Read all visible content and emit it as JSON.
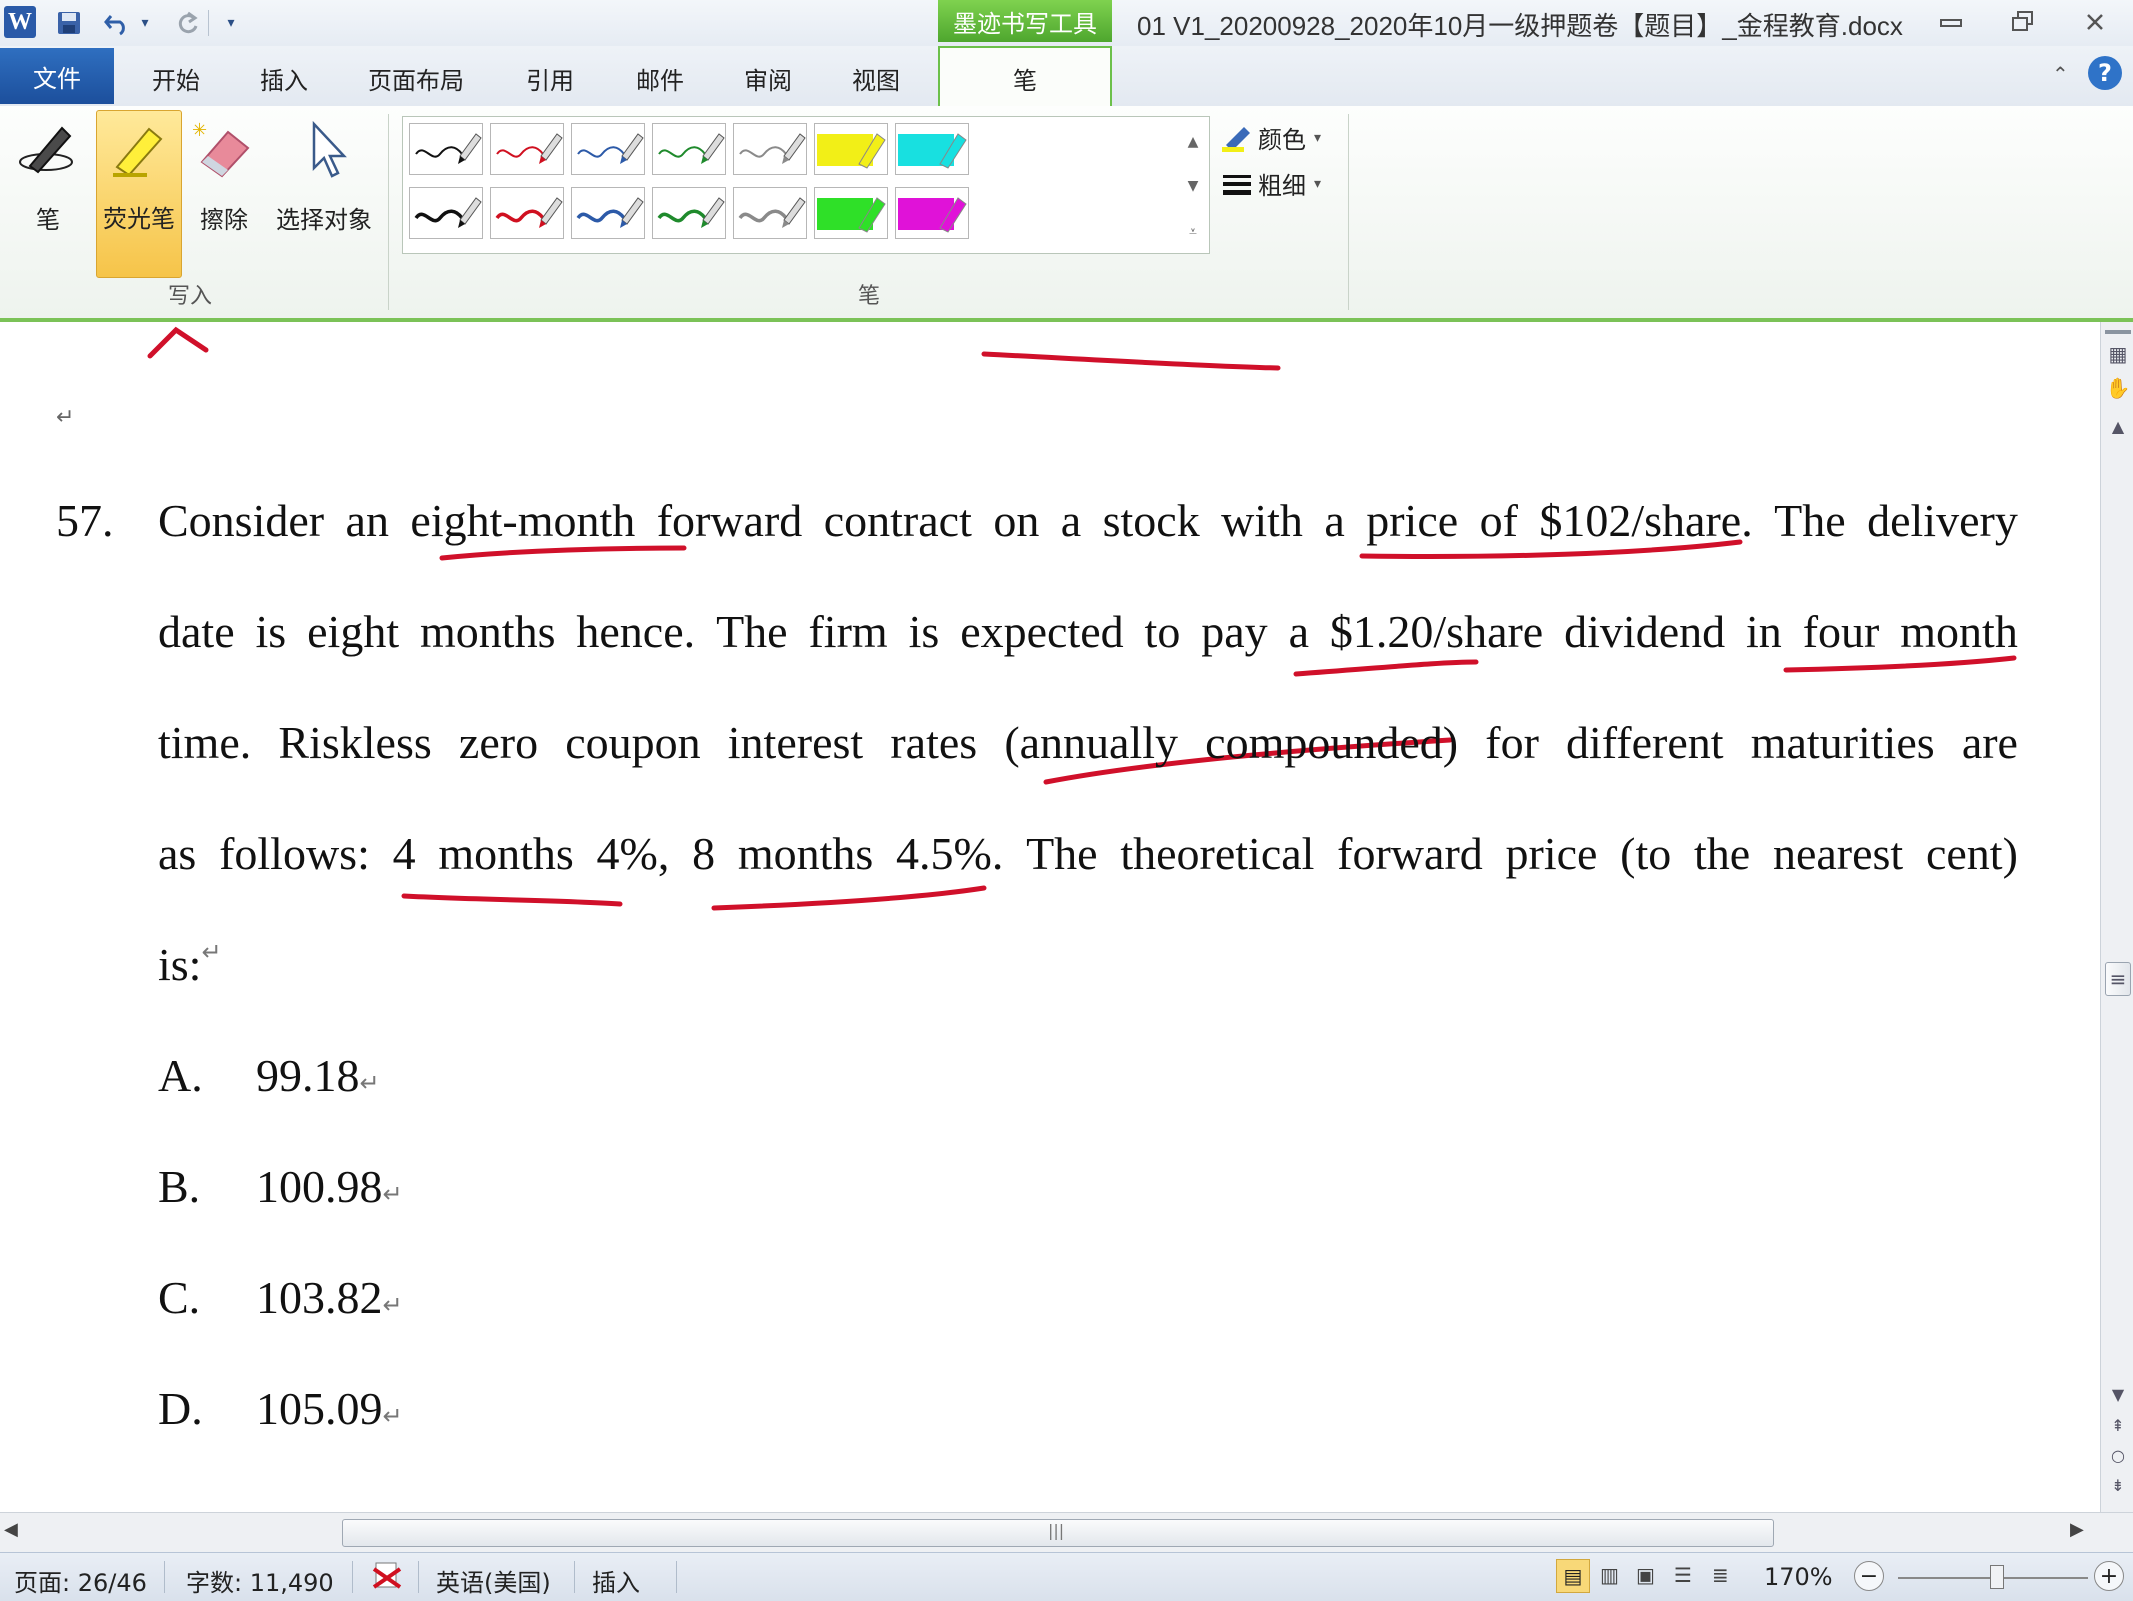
{
  "quick_access": {
    "app_icon": "W",
    "save_icon": "save-icon",
    "undo_icon": "undo-icon",
    "redo_icon": "redo-icon",
    "customize_icon": "chevron-down-icon"
  },
  "title_bar": {
    "context_tab": "墨迹书写工具",
    "document_title": "01 V1_20200928_2020年10月一级押题卷【题目】_金程教育.docx"
  },
  "tabs": [
    "开始",
    "插入",
    "页面布局",
    "引用",
    "邮件",
    "审阅",
    "视图"
  ],
  "file_tab": "文件",
  "active_tab": "笔",
  "ribbon": {
    "write_group": {
      "label": "写入",
      "pen": "笔",
      "highlighter": "荧光笔",
      "eraser": "擦除",
      "select_objects": "选择对象"
    },
    "pens_group": {
      "label": "笔",
      "color": "颜色",
      "weight": "粗细"
    },
    "pen_swatch_colors": [
      "#111111",
      "#d01020",
      "#2c5aa8",
      "#1f8a2c",
      "#8a8a8a",
      "#f2ef17",
      "#18e0e0",
      "#111111",
      "#d01020",
      "#2c5aa8",
      "#1f8a2c",
      "#8a8a8a",
      "#2fe028",
      "#e012d8"
    ]
  },
  "document": {
    "question_number": "57.",
    "question_lines": [
      [
        "Consider",
        "an",
        "eight-month",
        "forward",
        "contract",
        "on",
        "a",
        "stock",
        "with",
        "a",
        "price",
        "of",
        "$102/share.",
        "The",
        "delivery"
      ],
      [
        "date",
        "is",
        "eight",
        "months",
        "hence.",
        "The",
        "firm",
        "is",
        "expected",
        "to",
        "pay",
        "a",
        "$1.20/share",
        "dividend",
        "in",
        "four",
        "month"
      ],
      [
        "time.",
        "Riskless",
        "zero",
        "coupon",
        "interest",
        "rates",
        "(annually",
        "compounded)",
        "for",
        "different",
        "maturities",
        "are"
      ],
      [
        "as",
        "follows:",
        "4",
        "months",
        "4%,",
        "8",
        "months",
        "4.5%.",
        "The",
        "theoretical",
        "forward",
        "price",
        "(to",
        "the",
        "nearest",
        "cent)"
      ],
      [
        "is:"
      ]
    ],
    "paragraph_mark": "↵",
    "options": [
      {
        "letter": "A.",
        "value": "99.18"
      },
      {
        "letter": "B.",
        "value": "100.98"
      },
      {
        "letter": "C.",
        "value": "103.82"
      },
      {
        "letter": "D.",
        "value": "105.09"
      }
    ],
    "ink_color": "#d0102a"
  },
  "status_bar": {
    "page": "页面: 26/46",
    "word_count": "字数: 11,490",
    "language": "英语(美国)",
    "mode": "插入",
    "zoom": "170%",
    "zoom_minus": "−",
    "zoom_plus": "+"
  }
}
